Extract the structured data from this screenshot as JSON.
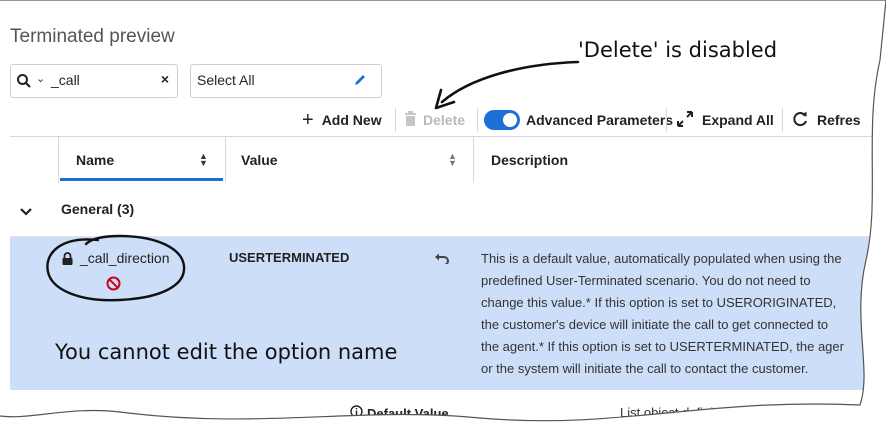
{
  "panel_title": "Terminated preview",
  "search": {
    "value": "_call"
  },
  "select_all": {
    "label": "Select All"
  },
  "toolbar": {
    "add_new": "Add New",
    "delete": "Delete",
    "advanced_parameters": "Advanced Parameters",
    "advanced_parameters_on": true,
    "expand_all": "Expand All",
    "refresh": "Refres"
  },
  "table": {
    "headers": {
      "name": "Name",
      "value": "Value",
      "description": "Description"
    },
    "group": {
      "label": "General (3)"
    },
    "row": {
      "name": "_call_direction",
      "value": "USERTERMINATED",
      "description_lines": [
        "This is a default value, automatically populated when using the",
        "predefined User-Terminated scenario. You do not need to",
        "change this value.* If this option is set to USERORIGINATED,",
        "the customer's device will initiate the call to get connected to",
        "the agent.* If this option is set to USERTERMINATED, the ager",
        "or the system will initiate the call to contact the customer."
      ]
    },
    "next_row": {
      "default_value_label": "Default Value",
      "description_line": "List object defining the Callback"
    }
  },
  "annotations": {
    "delete_disabled": "'Delete' is disabled",
    "name_not_editable": "You cannot edit the option name"
  },
  "colors": {
    "accent": "#1d6fd8",
    "selected_row": "#cddef8",
    "no_entry": "#d0021b"
  }
}
